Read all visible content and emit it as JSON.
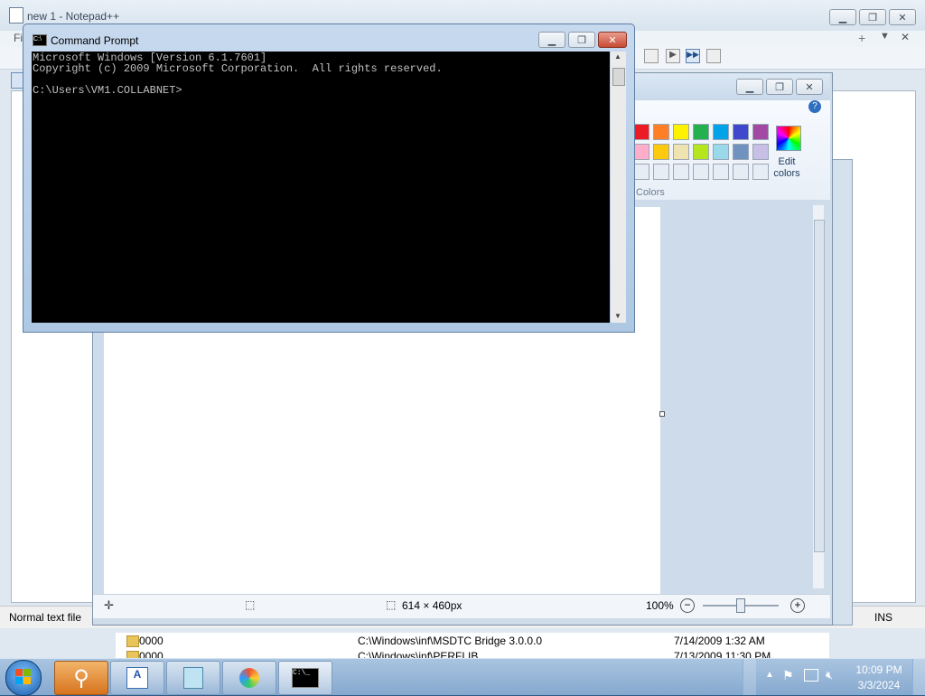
{
  "notepad": {
    "title": "new 1 - Notepad++",
    "menu_first": "Fi",
    "status_left": "Normal text file",
    "status_right": "INS",
    "close_tab_glyph": "✕",
    "plus_glyph": "+",
    "down_glyph": "▼"
  },
  "paint": {
    "edit_colors": "Edit colors",
    "colors_group": "Colors",
    "image_size": "614 × 460px",
    "zoom": "100%",
    "help_glyph": "?",
    "palette_row1": [
      "#ed1c24",
      "#ff7f27",
      "#fff200",
      "#22b14c",
      "#00a2e8",
      "#3f48cc",
      "#a349a4"
    ],
    "palette_row2": [
      "#ffaec9",
      "#ffc90e",
      "#efe4b0",
      "#b5e61d",
      "#99d9ea",
      "#7092be",
      "#c8bfe7"
    ]
  },
  "cmd": {
    "title": "Command Prompt",
    "line1": "Microsoft Windows [Version 6.1.7601]",
    "line2": "Copyright (c) 2009 Microsoft Corporation.  All rights reserved.",
    "line3": "C:\\Users\\VM1.COLLABNET>"
  },
  "filelist": {
    "name1": "0000",
    "path1": "C:\\Windows\\inf\\MSDTC Bridge 3.0.0.0",
    "date1": "7/14/2009 1:32 AM",
    "name2": "0000",
    "path2": "C:\\Windows\\inf\\PERFLIB",
    "date2": "7/13/2009 11:30 PM"
  },
  "taskbar": {
    "time": "10:09 PM",
    "date": "3/3/2024"
  },
  "icons": {
    "minimize": "minimize-icon",
    "maximize": "maximize-icon",
    "close": "close-icon"
  }
}
